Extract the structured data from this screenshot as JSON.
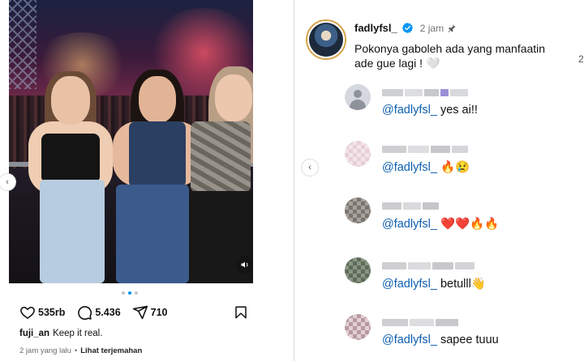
{
  "post": {
    "likes": "535rb",
    "comments": "5.436",
    "shares": "710",
    "caption_user": "fuji_an",
    "caption_text": "Keep it real.",
    "time": "2 jam yang lalu",
    "see_translation": "Lihat terjemahan",
    "carousel_dots": 3,
    "carousel_active": 1
  },
  "owner_comment": {
    "username": "fadlyfsl_",
    "time": "2 jam",
    "text": "Pokonya gaboleh ada yang manfaatin ade gue lagi ! 🤍",
    "edge_number": "2"
  },
  "replies": [
    {
      "mention": "@fadlyfsl_",
      "text": " yes ai!!",
      "avatar": "default-avatar"
    },
    {
      "mention": "@fadlyfsl_",
      "text": " 🔥😢",
      "avatar": "pixelated-avatar"
    },
    {
      "mention": "@fadlyfsl_",
      "text": " ❤️❤️🔥🔥",
      "avatar": "pixelated-avatar"
    },
    {
      "mention": "@fadlyfsl_",
      "text": " betulll👋",
      "avatar": "pixelated-avatar"
    },
    {
      "mention": "@fadlyfsl_",
      "text": " sapee tuuu",
      "avatar": "pixelated-avatar"
    }
  ],
  "colors": {
    "mention": "#0d5fb0",
    "verified": "#0095f6",
    "active_dot": "#0095f6",
    "meta_text": "#737373"
  },
  "icons": [
    "heart-icon",
    "comment-icon",
    "share-icon",
    "bookmark-icon",
    "sound-icon",
    "verified-icon",
    "pin-icon",
    "chevron-left-icon"
  ]
}
